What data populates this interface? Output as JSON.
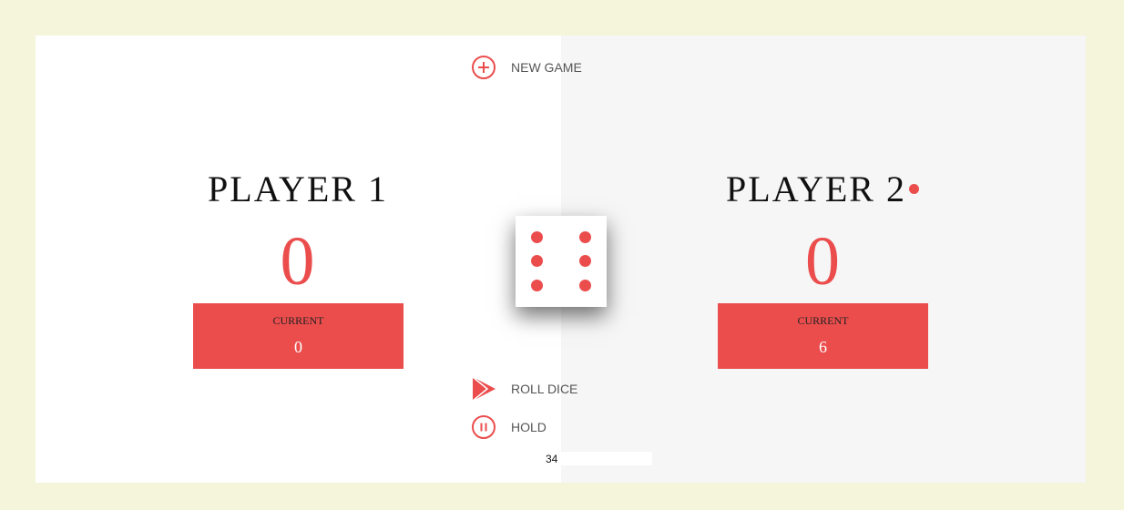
{
  "players": [
    {
      "name": "PLAYER 1",
      "score": "0",
      "current_label": "Current",
      "current": "0",
      "active": false
    },
    {
      "name": "PLAYER 2",
      "score": "0",
      "current_label": "Current",
      "current": "6",
      "active": true
    }
  ],
  "controls": {
    "new_game": {
      "label": "NEW GAME",
      "icon": "plus-circle-icon"
    },
    "roll_dice": {
      "label": "ROLL DICE",
      "icon": "play-arrow-icon"
    },
    "hold": {
      "label": "HOLD",
      "icon": "pause-circle-icon"
    }
  },
  "dice": {
    "value": 6
  },
  "final_score_input": {
    "value": "34"
  },
  "colors": {
    "accent": "#eb4d4d",
    "page_bg": "#f5f5db",
    "panel_active_bg": "#f6f6f6",
    "panel_bg": "#ffffff"
  }
}
